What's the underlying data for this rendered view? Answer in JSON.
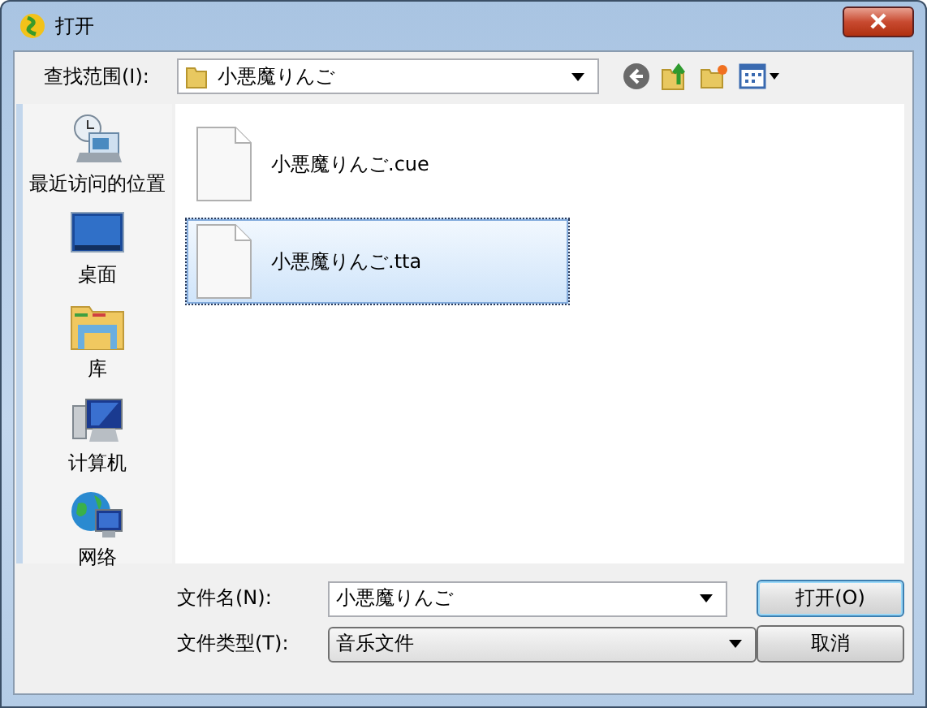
{
  "window": {
    "title": "打开"
  },
  "look_in": {
    "label": "查找范围(I):",
    "value": "小悪魔りんご"
  },
  "toolbar": [
    {
      "kind": "back"
    },
    {
      "kind": "up"
    },
    {
      "kind": "new-folder"
    },
    {
      "kind": "views"
    }
  ],
  "places": [
    {
      "label": "最近访问的位置",
      "kind": "recent"
    },
    {
      "label": "桌面",
      "kind": "desktop"
    },
    {
      "label": "库",
      "kind": "library"
    },
    {
      "label": "计算机",
      "kind": "computer"
    },
    {
      "label": "网络",
      "kind": "network"
    }
  ],
  "files": [
    {
      "name": "小悪魔りんご.cue",
      "selected": false
    },
    {
      "name": "小悪魔りんご.tta",
      "selected": true
    }
  ],
  "file_name": {
    "label": "文件名(N):",
    "value": "小悪魔りんご"
  },
  "file_type": {
    "label": "文件类型(T):",
    "value": "音乐文件"
  },
  "buttons": [
    {
      "label": "打开(O)",
      "kind": "default"
    },
    {
      "label": "取消",
      "kind": "normal"
    }
  ]
}
